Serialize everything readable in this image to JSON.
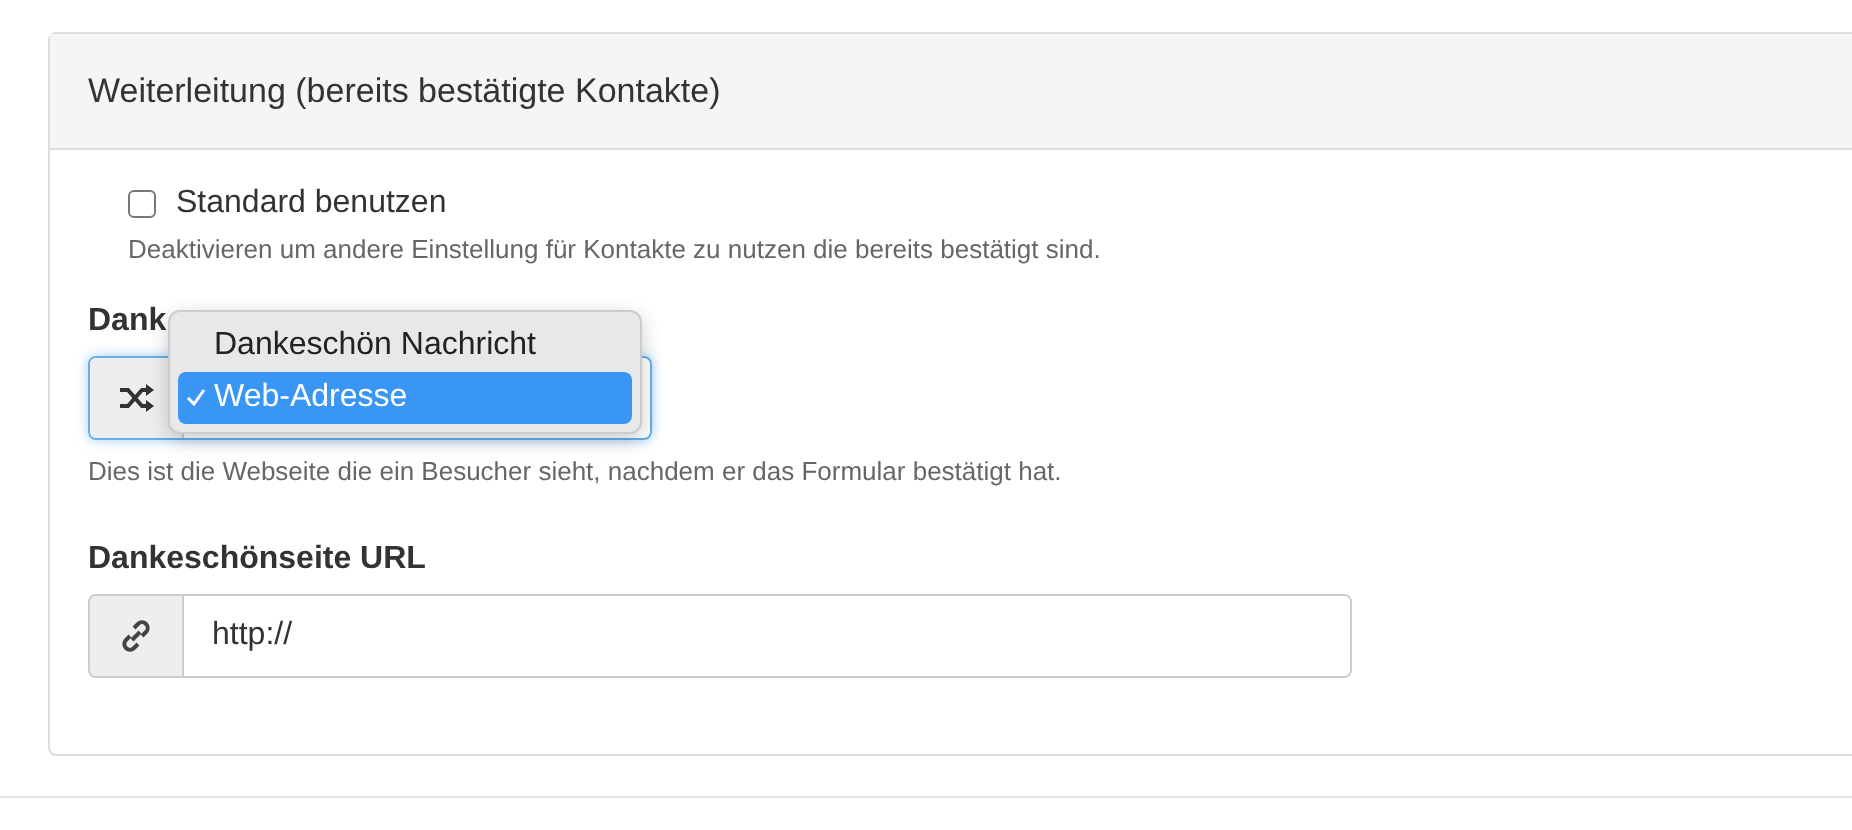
{
  "panel": {
    "title": "Weiterleitung (bereits bestätigte Kontakte)",
    "default_option": {
      "label": "Standard benutzen",
      "checked": false,
      "help": "Deaktivieren um andere Einstellung für Kontakte zu nutzen die bereits bestätigt sind."
    },
    "page_type": {
      "label": "Dank",
      "help": "Dies ist die Webseite die ein Besucher sieht, nachdem er das Formular bestätigt hat.",
      "options": [
        {
          "label": "Dankeschön Nachricht",
          "selected": false
        },
        {
          "label": "Web-Adresse",
          "selected": true
        }
      ]
    },
    "url": {
      "label": "Dankeschönseite URL",
      "value": "http://"
    }
  }
}
